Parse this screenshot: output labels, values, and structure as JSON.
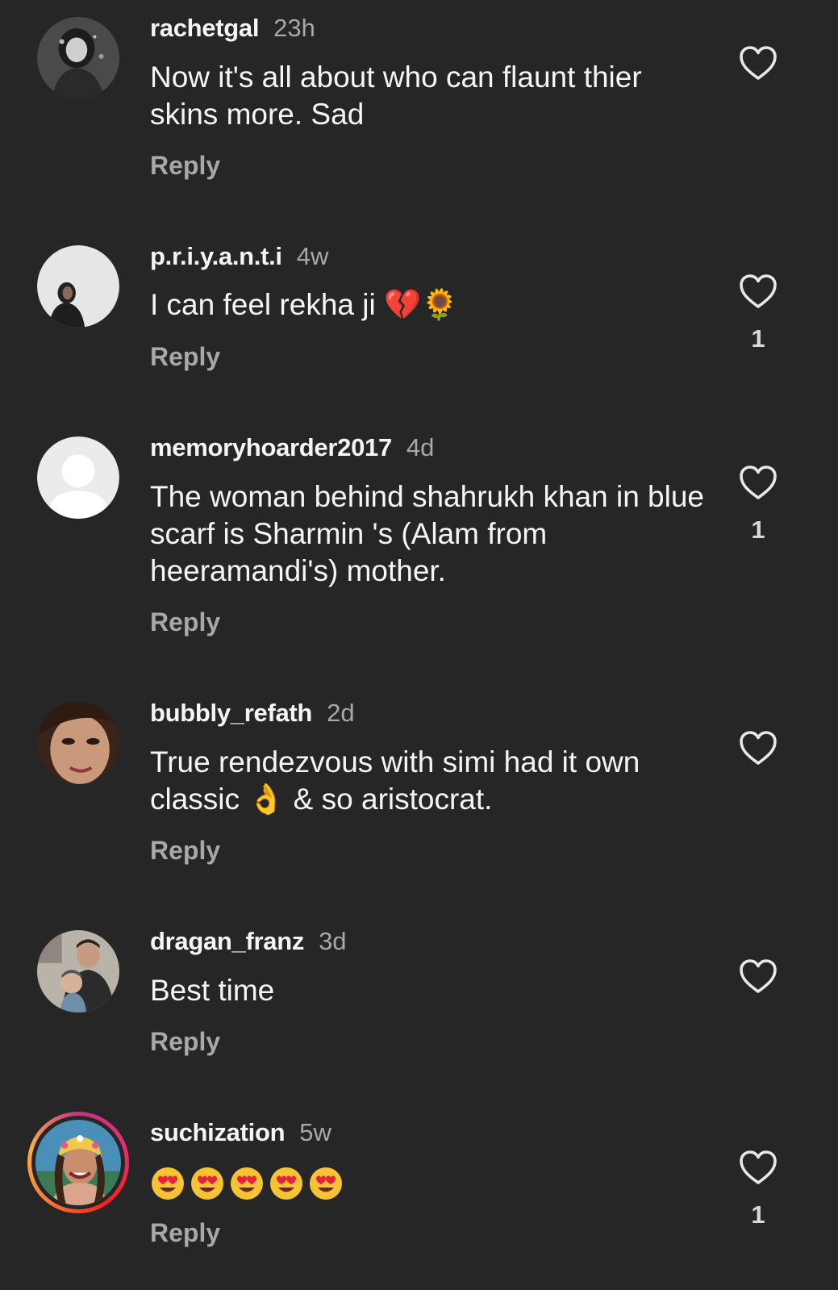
{
  "comments": [
    {
      "username": "rachetgal",
      "time": "23h",
      "text": "Now it's all about who can flaunt thier skins more. Sad",
      "reply": "Reply",
      "likes": ""
    },
    {
      "username": "p.r.i.y.a.n.t.i",
      "time": "4w",
      "text": "I can feel rekha ji",
      "text_emoji": "💔🌻",
      "reply": "Reply",
      "likes": "1"
    },
    {
      "username": "memoryhoarder2017",
      "time": "4d",
      "text": "The woman behind shahrukh khan in blue scarf is Sharmin 's (Alam from heeramandi's) mother.",
      "reply": "Reply",
      "likes": "1"
    },
    {
      "username": "bubbly_refath",
      "time": "2d",
      "text_part1": "True rendezvous with simi had it own classic",
      "text_emoji": "👌",
      "text_part2": "& so aristocrat.",
      "reply": "Reply",
      "likes": ""
    },
    {
      "username": "dragan_franz",
      "time": "3d",
      "text": "Best time",
      "reply": "Reply",
      "likes": ""
    },
    {
      "username": "suchization",
      "time": "5w",
      "text_emoji": "😍😍😍😍😍",
      "reply": "Reply",
      "likes": "1"
    }
  ],
  "icons": {
    "like": "heart-outline-icon",
    "default_avatar": "default-avatar-icon"
  },
  "colors": {
    "background": "#262626",
    "text": "#f5f5f5",
    "secondary": "#a8a8a8",
    "story_ring_start": "#c13584",
    "story_ring_end": "#fcaf45"
  }
}
